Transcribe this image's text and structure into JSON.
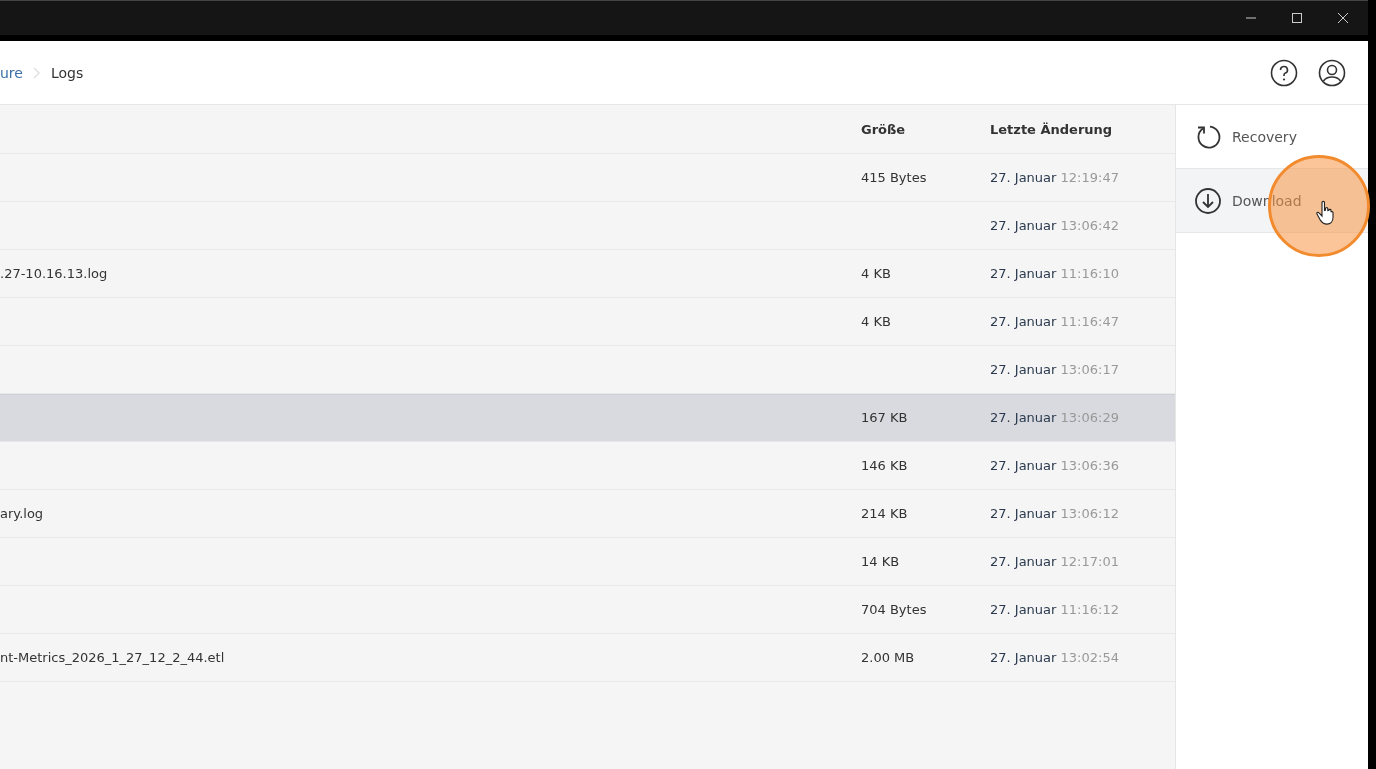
{
  "breadcrumb": [
    {
      "label": "ure",
      "link": true
    },
    {
      "label": "Logs",
      "link": false
    }
  ],
  "table": {
    "columns": [
      "Größe",
      "Letzte Änderung"
    ],
    "rows": [
      {
        "size": "415 Bytes",
        "date": "27. Januar",
        "time": "12:19:47",
        "selected": false
      },
      {
        "date": "27. Januar",
        "time": "13:06:42",
        "selected": false
      },
      {
        "name": ".27-10.16.13.log",
        "size": "4 KB",
        "date": "27. Januar",
        "time": "11:16:10",
        "selected": false
      },
      {
        "size": "4 KB",
        "date": "27. Januar",
        "time": "11:16:47",
        "selected": false
      },
      {
        "date": "27. Januar",
        "time": "13:06:17",
        "selected": false
      },
      {
        "size": "167 KB",
        "date": "27. Januar",
        "time": "13:06:29",
        "selected": true
      },
      {
        "size": "146 KB",
        "date": "27. Januar",
        "time": "13:06:36",
        "selected": false
      },
      {
        "name": "ary.log",
        "size": "214 KB",
        "date": "27. Januar",
        "time": "13:06:12",
        "selected": false
      },
      {
        "size": "14 KB",
        "date": "27. Januar",
        "time": "12:17:01",
        "selected": false
      },
      {
        "size": "704 Bytes",
        "date": "27. Januar",
        "time": "11:16:12",
        "selected": false
      },
      {
        "name": "nt-Metrics_2026_1_27_12_2_44.etl",
        "size": "2.00 MB",
        "date": "27. Januar",
        "time": "13:02:54",
        "selected": false
      }
    ]
  },
  "actions": [
    {
      "kind": "recovery",
      "label": "Recovery",
      "selected": false
    },
    {
      "kind": "download",
      "label": "Download",
      "selected": true
    }
  ]
}
